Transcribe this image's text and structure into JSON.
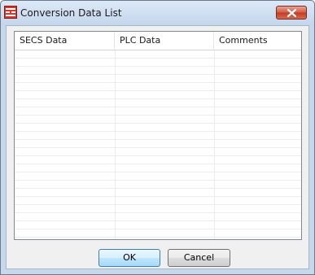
{
  "window": {
    "title": "Conversion Data List",
    "icon": "app-list-icon",
    "close_icon": "close-icon"
  },
  "list": {
    "columns": [
      "SECS Data",
      "PLC Data",
      "Comments"
    ],
    "rows": []
  },
  "buttons": {
    "ok_label": "OK",
    "cancel_label": "Cancel"
  },
  "colors": {
    "title_bar": "#c4d6ec",
    "close_button": "#c23a22",
    "ok_button_border": "#3c7fb1"
  }
}
